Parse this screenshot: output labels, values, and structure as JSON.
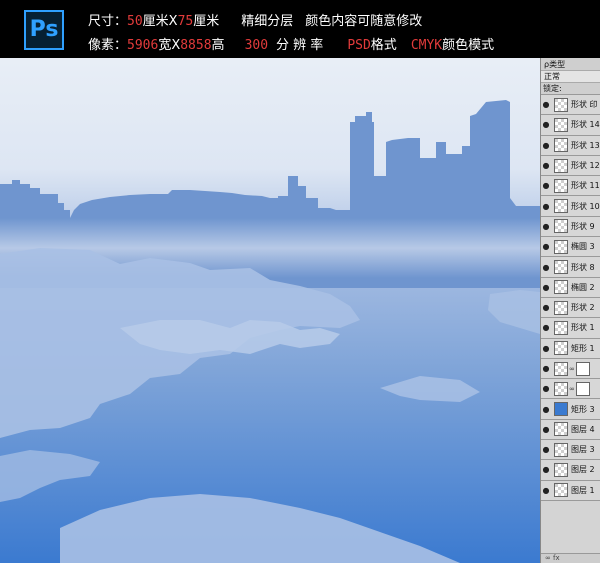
{
  "banner": {
    "logo": "Ps",
    "line1": {
      "size_label": "尺寸：",
      "width": "50",
      "unit_x": "厘米X",
      "height": "75",
      "unit": "厘米",
      "layered": "精细分层",
      "desc": "颜色内容可随意修改"
    },
    "line2": {
      "pixel_label": "像素：",
      "px_w": "5906",
      "wide": "宽X",
      "px_h": "8858",
      "high": "高",
      "dpi": "300",
      "dpi_label": "分 辨 率",
      "format": "PSD",
      "format_label": "格式",
      "mode": "CMYK",
      "mode_label": "颜色模式"
    }
  },
  "layers_panel": {
    "filter_label": "ρ类型",
    "blend_mode": "正常",
    "lock_label": "锁定:",
    "layers": [
      {
        "name": "形状 印",
        "thumb": "checker"
      },
      {
        "name": "形状 14",
        "thumb": "checker"
      },
      {
        "name": "形状 13",
        "thumb": "checker"
      },
      {
        "name": "形状 12",
        "thumb": "checker"
      },
      {
        "name": "形状 11",
        "thumb": "checker"
      },
      {
        "name": "形状 10",
        "thumb": "checker"
      },
      {
        "name": "形状 9",
        "thumb": "checker"
      },
      {
        "name": "椭圆 3",
        "thumb": "checker"
      },
      {
        "name": "形状 8",
        "thumb": "checker"
      },
      {
        "name": "椭圆 2",
        "thumb": "checker"
      },
      {
        "name": "形状 2",
        "thumb": "checker"
      },
      {
        "name": "形状 1",
        "thumb": "checker"
      },
      {
        "name": "矩形 1",
        "thumb": "checker"
      },
      {
        "name": "",
        "thumb": "mask"
      },
      {
        "name": "",
        "thumb": "mask"
      },
      {
        "name": "矩形 3",
        "thumb": "blue"
      },
      {
        "name": "图层 4",
        "thumb": "checker"
      },
      {
        "name": "图层 3",
        "thumb": "checker"
      },
      {
        "name": "图层 2",
        "thumb": "checker"
      },
      {
        "name": "图层 1",
        "thumb": "checker"
      }
    ],
    "footer": "∞ fx"
  },
  "colors": {
    "sky_top": "#e8eef6",
    "skyline": "#6f95cf",
    "water_bottom": "#3b7ad0",
    "land": "#a9c0e4"
  }
}
